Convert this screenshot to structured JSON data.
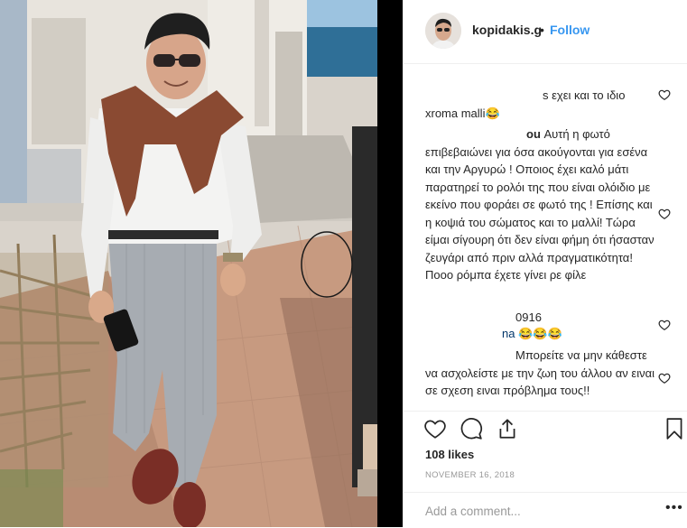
{
  "post": {
    "username": "kopidakis.g",
    "separator": "•",
    "follow_label": "Follow",
    "likes": "108 likes",
    "date": "NOVEMBER 16, 2018",
    "add_comment_placeholder": "Add a comment...",
    "more_label": "•••"
  },
  "comments": [
    {
      "text": "s εχει και το ιδιο\nxroma malli😂"
    },
    {
      "text_a": "ou",
      "text_b": " Αυτή η φωτό επιβεβαιώνει για όσα ακούγονται για εσένα και την Αργυρώ ! Οποιος έχει καλό μάτι παρατηρεί το ρολόι της που είναι ολόιδιο με εκείνο που φοράει σε φωτό της ! Επίσης και η κοψιά του σώματος και το μαλλί! Τώρα είμαι σίγουρη ότι δεν είναι φήμη ότι ήσασταν ζευγάρι από πριν αλλά πραγματικότητα! Ποοο ρόμπα έχετε γίνει ρε φίλε"
    },
    {
      "text": "0916"
    },
    {
      "mention": "na",
      "text": " 😂😂😂"
    },
    {
      "text": "Μπορείτε να μην κάθεστε να ασχολείστε με την ζωη του άλλου αν ειναι σε σχεση ειναι πρόβλημα τους!!"
    }
  ],
  "icons": {
    "like": "heart-icon",
    "comment": "comment-icon",
    "share": "share-icon",
    "save": "bookmark-icon",
    "comment_like": "heart-icon"
  }
}
